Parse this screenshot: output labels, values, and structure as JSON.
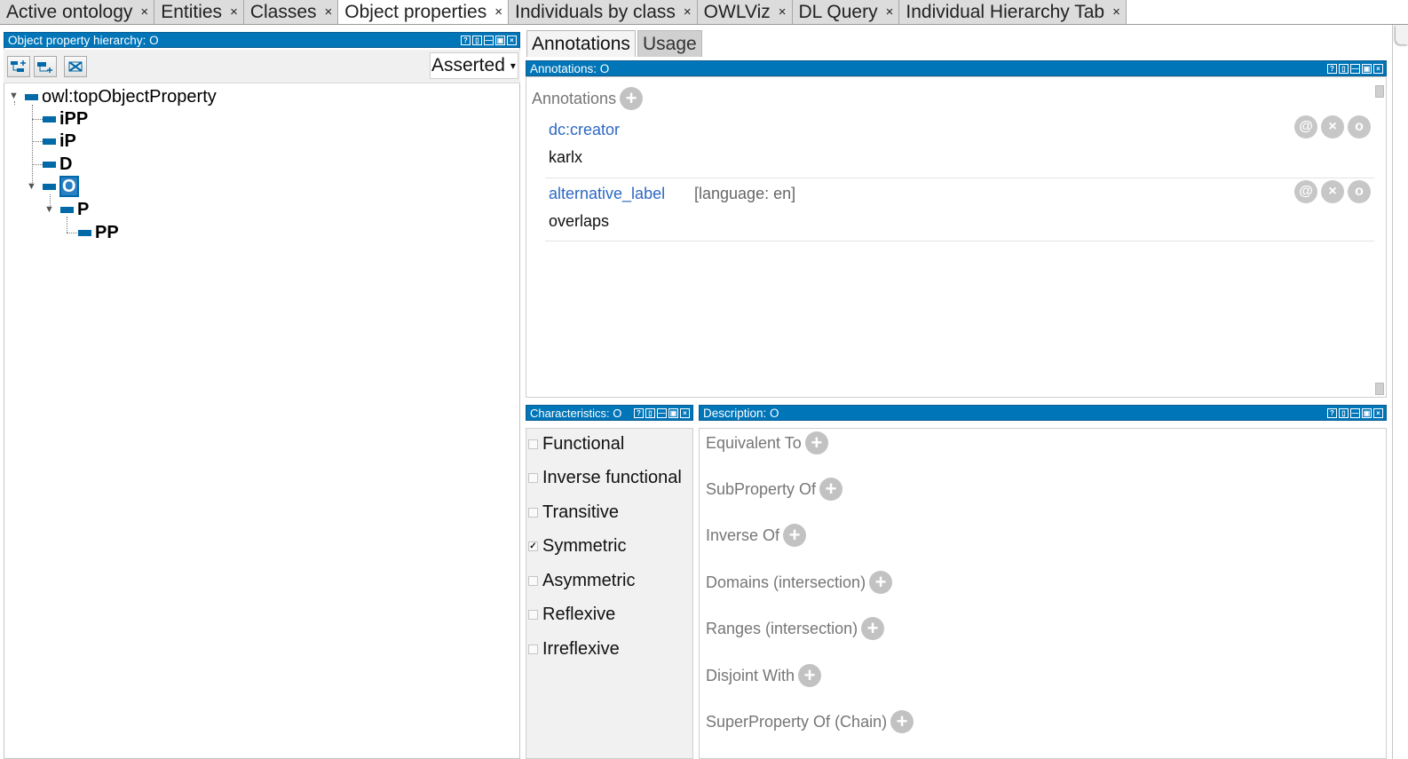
{
  "tabs": [
    {
      "label": "Active ontology"
    },
    {
      "label": "Entities"
    },
    {
      "label": "Classes"
    },
    {
      "label": "Object properties",
      "active": true
    },
    {
      "label": "Individuals by class"
    },
    {
      "label": "OWLViz"
    },
    {
      "label": "DL Query"
    },
    {
      "label": "Individual Hierarchy Tab"
    }
  ],
  "tab_close_glyph": "×",
  "hierarchy": {
    "title": "Object property hierarchy: O",
    "mode": "Asserted",
    "tree": [
      "owl:topObjectProperty",
      "iPP",
      "iP",
      "D",
      "O",
      "P",
      "PP"
    ],
    "selected": "O"
  },
  "subtabs": [
    "Annotations",
    "Usage"
  ],
  "annotations": {
    "title": "Annotations: O",
    "header": "Annotations",
    "items": [
      {
        "property": "dc:creator",
        "value": "karlx",
        "language": ""
      },
      {
        "property": "alternative_label",
        "value": "overlaps",
        "language": "[language: en]"
      }
    ],
    "action_icons": [
      "@",
      "×",
      "o"
    ]
  },
  "characteristics": {
    "title": "Characteristics: O",
    "items": [
      {
        "label": "Functional",
        "checked": false
      },
      {
        "label": "Inverse functional",
        "checked": false
      },
      {
        "label": "Transitive",
        "checked": false
      },
      {
        "label": "Symmetric",
        "checked": true
      },
      {
        "label": "Asymmetric",
        "checked": false
      },
      {
        "label": "Reflexive",
        "checked": false
      },
      {
        "label": "Irreflexive",
        "checked": false
      }
    ],
    "check_glyph": "✓"
  },
  "description": {
    "title": "Description: O",
    "sections": [
      "Equivalent To",
      "SubProperty Of",
      "Inverse Of",
      "Domains (intersection)",
      "Ranges (intersection)",
      "Disjoint With",
      "SuperProperty Of (Chain)"
    ]
  },
  "panel_controls": [
    "?",
    "▯",
    "—",
    "▣",
    "×"
  ],
  "plus_glyph": "+",
  "dropdown_caret": "▾",
  "colors": {
    "titlebar": "#0075b8",
    "link": "#2d68c4",
    "selection": "#2a7fc4"
  }
}
